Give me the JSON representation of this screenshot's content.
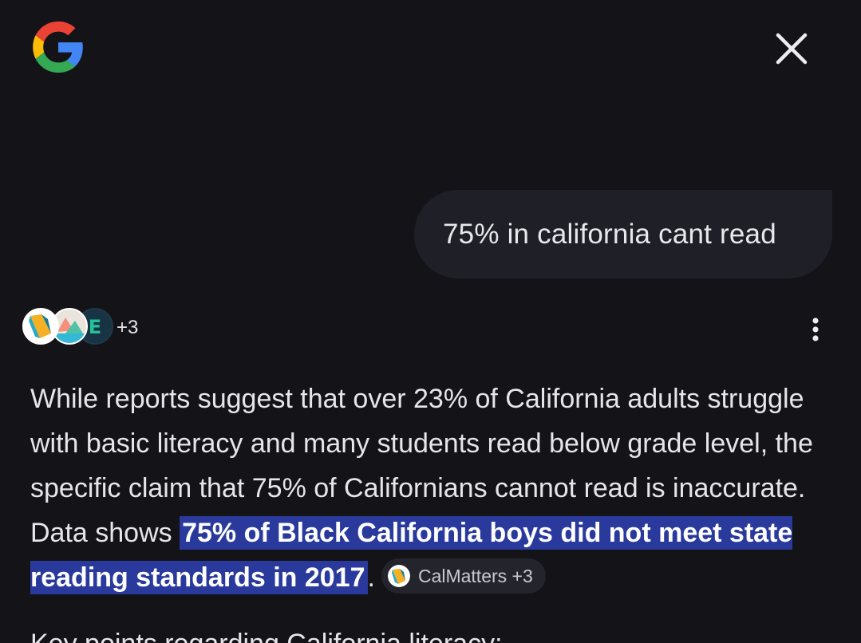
{
  "header": {
    "logo_icon": "google-g-icon",
    "close_icon": "close-icon"
  },
  "query": {
    "text": "75% in california cant read"
  },
  "sources": {
    "count_label": "+3",
    "icons": [
      "calmatters-icon",
      "source-2-icon",
      "source-3-icon"
    ],
    "more_icon": "more-vert-icon"
  },
  "answer": {
    "text_before": "While reports suggest that over 23% of California adults struggle with basic literacy and many students read below grade level, the specific claim that 75% of Californians cannot read is inaccurate. Data shows ",
    "highlight": "75% of Black California boys did not meet state reading standards in 2017",
    "text_after": ".",
    "citation_label": "CalMatters +3"
  },
  "next_paragraph": {
    "text": "Key points regarding California literacy:"
  },
  "colors": {
    "background": "#131318",
    "bubble": "#1f1f27",
    "highlight": "#2a3a9c",
    "chip": "#24242c"
  }
}
